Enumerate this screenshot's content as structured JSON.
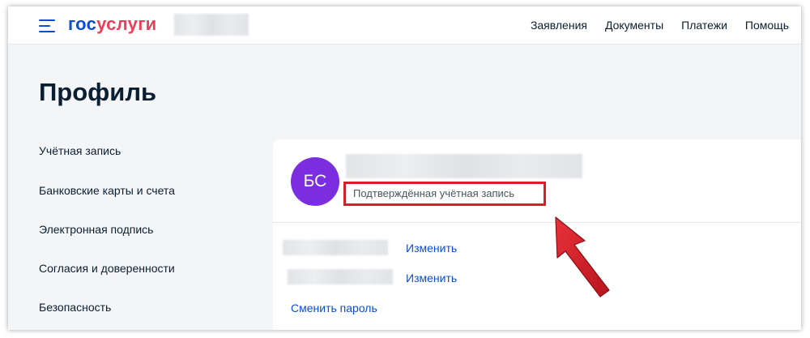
{
  "header": {
    "logo_part1": "гос",
    "logo_part2": "услуги",
    "nav": [
      "Заявления",
      "Документы",
      "Платежи",
      "Помощь"
    ]
  },
  "page": {
    "title": "Профиль"
  },
  "sidebar": {
    "items": [
      {
        "label": "Учётная запись"
      },
      {
        "label": "Банковские карты и счета"
      },
      {
        "label": "Электронная подпись"
      },
      {
        "label": "Согласия и доверенности"
      },
      {
        "label": "Безопасность"
      }
    ]
  },
  "profile": {
    "avatar_initials": "БС",
    "status": "Подтверждённая учётная запись",
    "rows": [
      {
        "action": "Изменить"
      },
      {
        "action": "Изменить"
      }
    ],
    "change_password": "Сменить пароль"
  },
  "colors": {
    "brand_blue": "#0d4cd3",
    "brand_red": "#ee3f58",
    "avatar_bg": "#7a2ee0",
    "highlight_red": "#d4202a"
  }
}
